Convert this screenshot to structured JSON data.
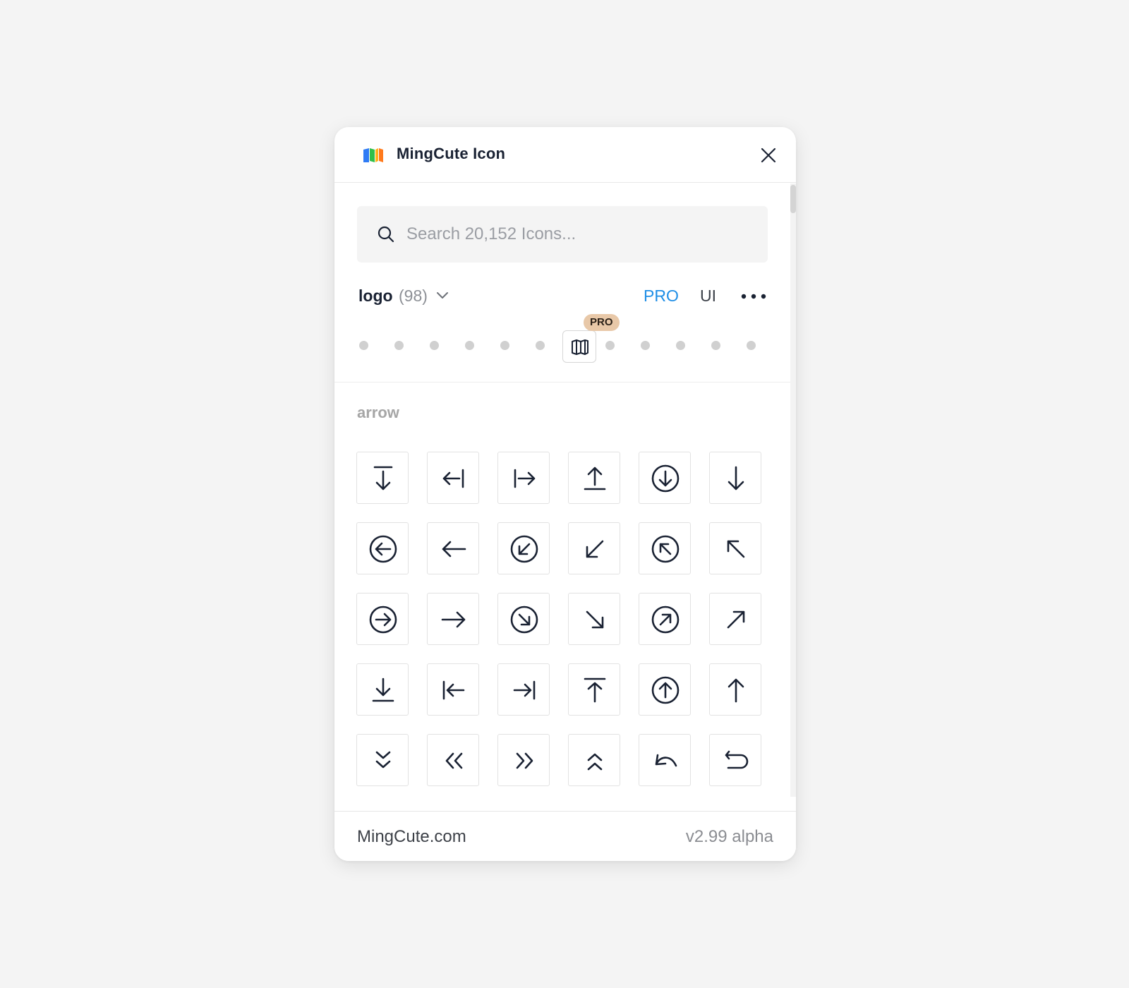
{
  "header": {
    "title": "MingCute Icon",
    "logo_icon": "mingcute-logo-icon",
    "close_icon": "close-icon"
  },
  "search": {
    "placeholder": "Search 20,152 Icons...",
    "value": ""
  },
  "filter": {
    "category": "logo",
    "count": "(98)",
    "tabs": [
      {
        "label": "PRO",
        "active": true
      },
      {
        "label": "UI",
        "active": false
      }
    ],
    "more_icon": "more-icon"
  },
  "style_selector": {
    "badge": "PRO",
    "selected_icon": "map-icon",
    "dot_count_before": 6,
    "dot_count_after": 5
  },
  "section": {
    "label": "arrow",
    "icons": [
      "arrow-to-down-icon",
      "arrow-to-left-icon",
      "arrow-to-right-icon",
      "arrow-up-line-icon",
      "arrow-down-circle-icon",
      "arrow-down-icon",
      "arrow-left-circle-icon",
      "arrow-left-icon",
      "arrow-left-down-circle-icon",
      "arrow-left-down-icon",
      "arrow-left-up-circle-icon",
      "arrow-left-up-icon",
      "arrow-right-circle-icon",
      "arrow-right-icon",
      "arrow-right-down-circle-icon",
      "arrow-right-down-icon",
      "arrow-right-up-circle-icon",
      "arrow-right-up-icon",
      "download-icon",
      "arrow-to-left-bar-icon",
      "arrow-to-right-bar-icon",
      "arrow-to-up-icon",
      "arrow-up-circle-icon",
      "arrow-up-icon",
      "arrows-down-icon",
      "arrows-left-icon",
      "arrows-right-icon",
      "arrows-up-icon",
      "back-icon",
      "back-2-icon"
    ]
  },
  "footer": {
    "site": "MingCute.com",
    "version": "v2.99 alpha"
  },
  "colors": {
    "accent": "#1e8ee6",
    "icon": "#1a2233",
    "pro_badge": "#e8c8a8"
  }
}
